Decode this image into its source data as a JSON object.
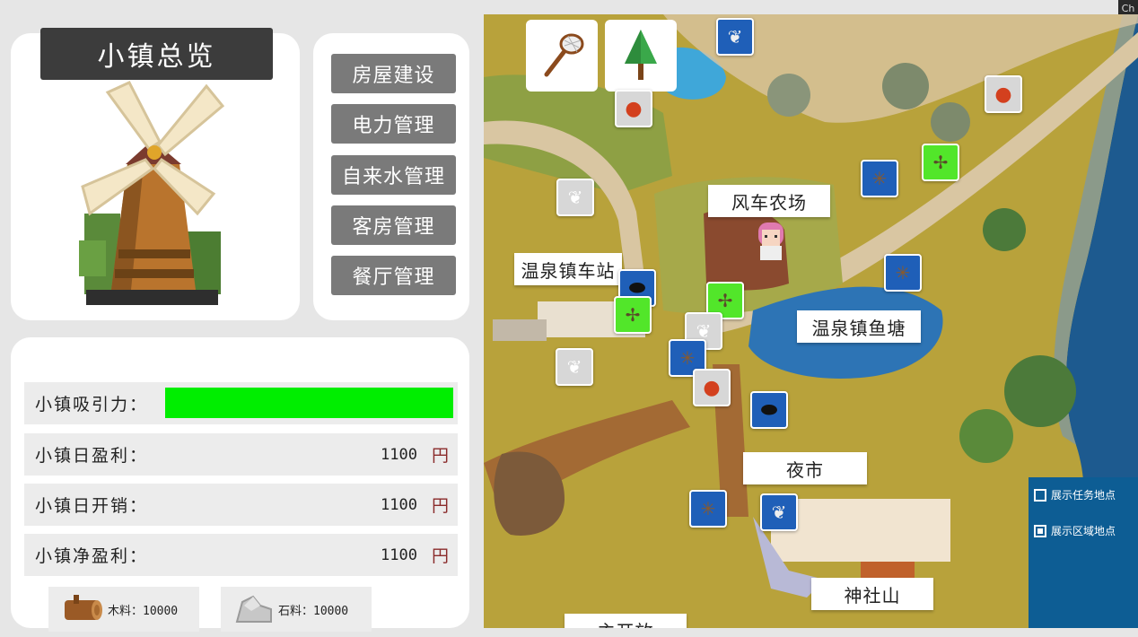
{
  "panel": {
    "title": "小镇总览",
    "management_buttons": [
      "房屋建设",
      "电力管理",
      "自来水管理",
      "客房管理",
      "餐厅管理"
    ]
  },
  "stats": {
    "attraction_label": "小镇吸引力：",
    "attraction_level": 1.0,
    "attraction_color": "#00ee00",
    "rows": [
      {
        "label": "小镇日盈利：",
        "value": "1100",
        "unit": "円"
      },
      {
        "label": "小镇日开销：",
        "value": "1100",
        "unit": "円"
      },
      {
        "label": "小镇净盈利：",
        "value": "1100",
        "unit": "円"
      }
    ]
  },
  "resources": [
    {
      "label": "木料：10000",
      "icon": "wood-log-icon"
    },
    {
      "label": "石料：10000",
      "icon": "stone-icon"
    }
  ],
  "map": {
    "tools": [
      "bug-net-icon",
      "tree-icon"
    ],
    "locations": [
      "风车农场",
      "温泉镇车站",
      "温泉镇鱼塘",
      "夜市",
      "神社山",
      "主开放"
    ],
    "markers": [
      {
        "type": "moth",
        "color": "#1f5fb8"
      },
      {
        "type": "ladybug",
        "color": "#d7d7d7"
      },
      {
        "type": "ladybug",
        "color": "#d7d7d7"
      },
      {
        "type": "cricket",
        "color": "#1f5fb8"
      },
      {
        "type": "dragonfly",
        "color": "#52e62a"
      },
      {
        "type": "moth",
        "color": "#d7d7d7"
      },
      {
        "type": "cricket",
        "color": "#1f5fb8"
      },
      {
        "type": "beetle",
        "color": "#1f5fb8"
      },
      {
        "type": "dragonfly",
        "color": "#52e62a"
      },
      {
        "type": "dragonfly",
        "color": "#52e62a"
      },
      {
        "type": "moth",
        "color": "#d7d7d7"
      },
      {
        "type": "moth",
        "color": "#d7d7d7"
      },
      {
        "type": "cricket",
        "color": "#1f5fb8"
      },
      {
        "type": "ladybug",
        "color": "#d7d7d7"
      },
      {
        "type": "beetle",
        "color": "#1f5fb8"
      },
      {
        "type": "cricket",
        "color": "#1f5fb8"
      },
      {
        "type": "moth",
        "color": "#1f5fb8"
      }
    ]
  },
  "legend": {
    "options": [
      {
        "label": "展示任务地点",
        "checked": false
      },
      {
        "label": "展示区域地点",
        "checked": true
      }
    ]
  },
  "corner_tab": "Ch"
}
